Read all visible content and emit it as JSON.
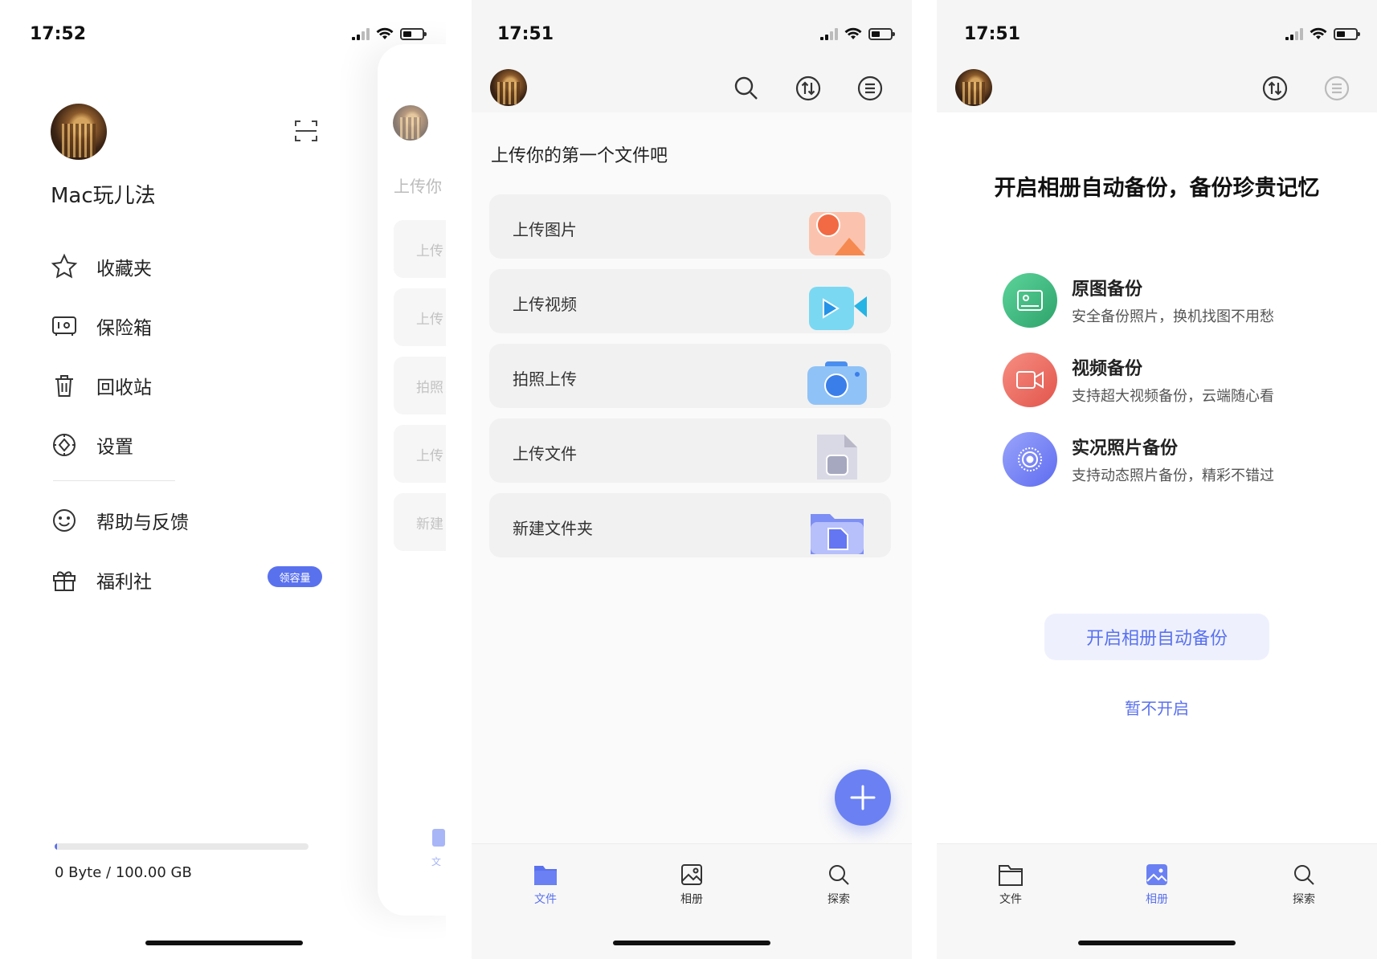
{
  "colors": {
    "accent": "#5a71ee",
    "green": "#3fb07a",
    "red": "#ee6b63",
    "purple": "#7b86f5"
  },
  "screen1": {
    "status_time": "17:52",
    "profile_name": "Mac玩儿法",
    "menu": [
      {
        "label": "收藏夹",
        "icon": "star-icon"
      },
      {
        "label": "保险箱",
        "icon": "safe-icon"
      },
      {
        "label": "回收站",
        "icon": "trash-icon"
      },
      {
        "label": "设置",
        "icon": "gear-icon"
      },
      {
        "label": "帮助与反馈",
        "icon": "smile-icon"
      },
      {
        "label": "福利社",
        "icon": "gift-icon"
      }
    ],
    "welfare_badge": "领容量",
    "storage_text": "0 Byte / 100.00 GB",
    "storage_used_fraction": 0.01,
    "peek": {
      "title": "上传你",
      "cards": [
        "上传",
        "上传",
        "拍照",
        "上传",
        "新建"
      ],
      "tab_label": "文"
    }
  },
  "screen2": {
    "status_time": "17:51",
    "heading": "上传你的第一个文件吧",
    "cards": [
      {
        "label": "上传图片",
        "icon": "image-upload-icon"
      },
      {
        "label": "上传视频",
        "icon": "video-upload-icon"
      },
      {
        "label": "拍照上传",
        "icon": "camera-upload-icon"
      },
      {
        "label": "上传文件",
        "icon": "file-upload-icon"
      },
      {
        "label": "新建文件夹",
        "icon": "new-folder-icon"
      }
    ],
    "tabs": [
      {
        "label": "文件",
        "icon": "folder-icon",
        "active": true
      },
      {
        "label": "相册",
        "icon": "album-icon",
        "active": false
      },
      {
        "label": "探索",
        "icon": "explore-icon",
        "active": false
      }
    ]
  },
  "screen3": {
    "status_time": "17:51",
    "heading": "开启相册自动备份，备份珍贵记忆",
    "features": [
      {
        "title": "原图备份",
        "desc": "安全备份照片，换机找图不用愁",
        "icon": "photo-backup-icon"
      },
      {
        "title": "视频备份",
        "desc": "支持超大视频备份，云端随心看",
        "icon": "video-backup-icon"
      },
      {
        "title": "实况照片备份",
        "desc": "支持动态照片备份，精彩不错过",
        "icon": "live-photo-icon"
      }
    ],
    "primary_button": "开启相册自动备份",
    "secondary_link": "暂不开启",
    "tabs": [
      {
        "label": "文件",
        "icon": "folder-icon",
        "active": false
      },
      {
        "label": "相册",
        "icon": "album-icon",
        "active": true
      },
      {
        "label": "探索",
        "icon": "explore-icon",
        "active": false
      }
    ]
  }
}
